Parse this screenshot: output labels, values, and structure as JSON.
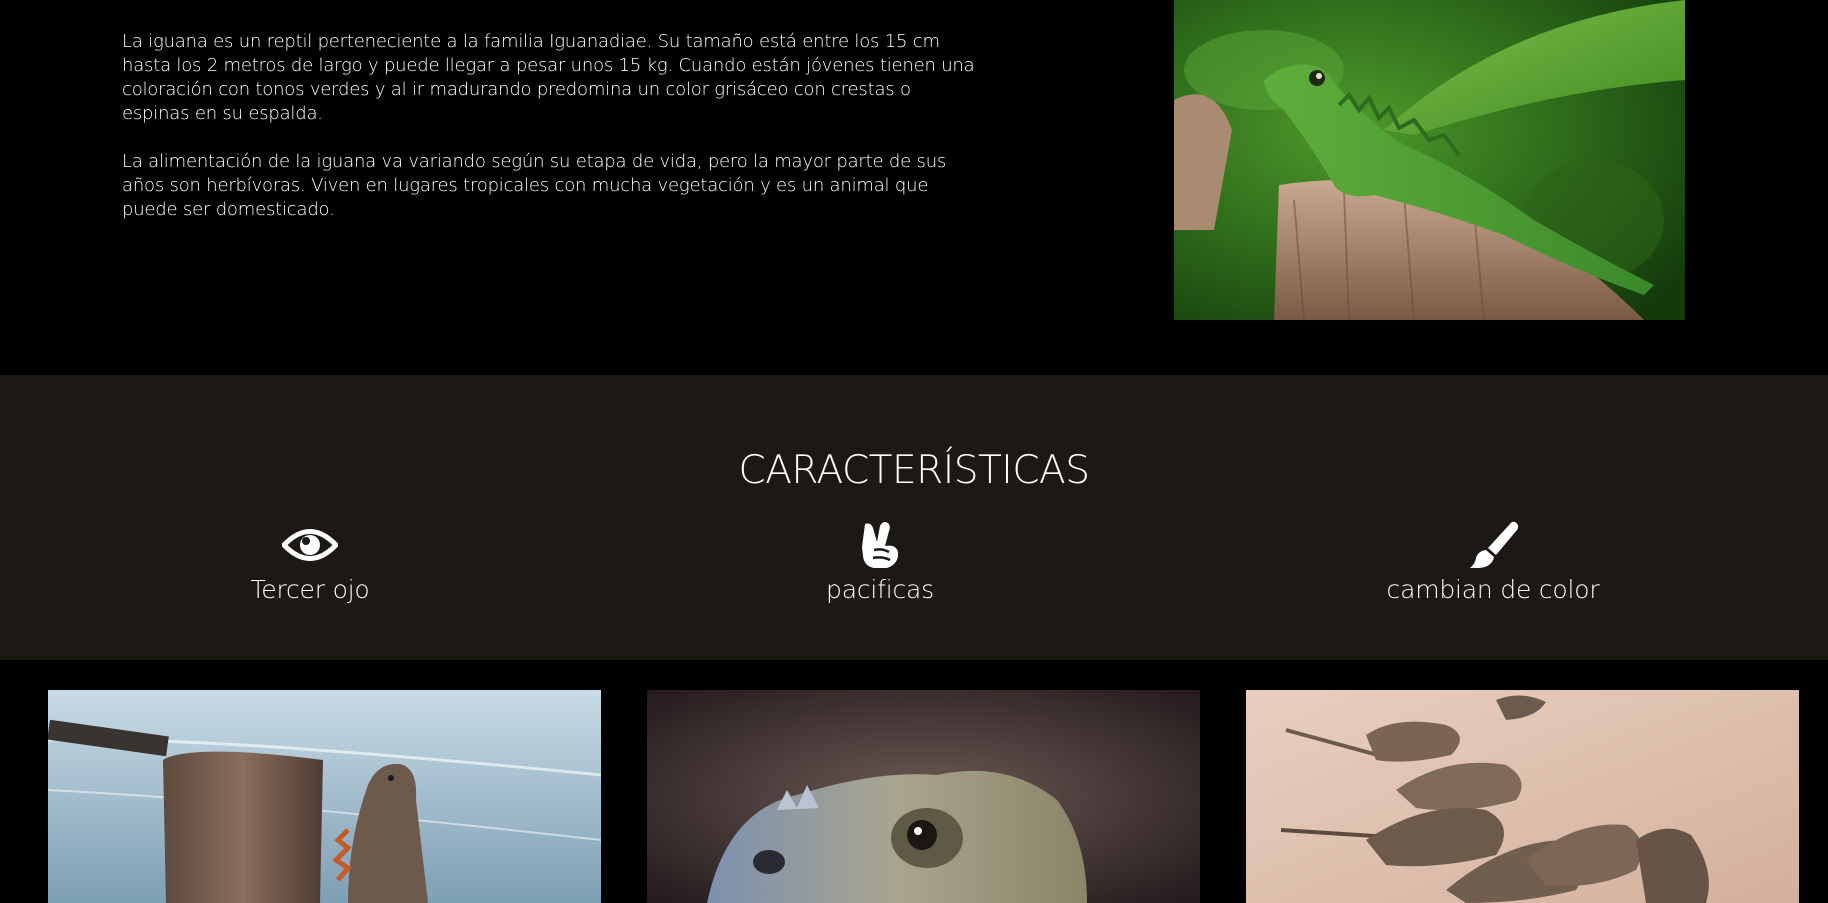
{
  "intro": {
    "paragraphs": [
      "La iguana es un reptil perteneciente a la familia Iguanadiae. Su tamaño está entre los 15 cm hasta los 2 metros de largo y puede llegar a pesar unos 15 kg. Cuando están jóvenes tienen una coloración con tonos verdes y al ir madurando predomina un color grisáceo con crestas o espinas en su espalda.",
      "La alimentación de la iguana va variando según su etapa de vida, pero la mayor parte de sus años son herbívoras. Viven en lugares tropicales con mucha vegetación y es un animal que puede ser domesticado."
    ],
    "photo_icon": "green-iguana-photo"
  },
  "features": {
    "title": "CARACTERÍSTICAS",
    "items": [
      {
        "icon": "eye-icon",
        "label": "Tercer ojo"
      },
      {
        "icon": "peace-hand-icon",
        "label": "pacificas"
      },
      {
        "icon": "paint-brush-icon",
        "label": "cambian de color"
      }
    ]
  },
  "gallery": {
    "photos": [
      "iguana-beach-post-photo",
      "iguana-closeup-photo",
      "iguanas-on-sand-photo"
    ]
  },
  "colors": {
    "page_background": "#000000",
    "features_background": "#1c1813",
    "text": "#ffffff"
  }
}
